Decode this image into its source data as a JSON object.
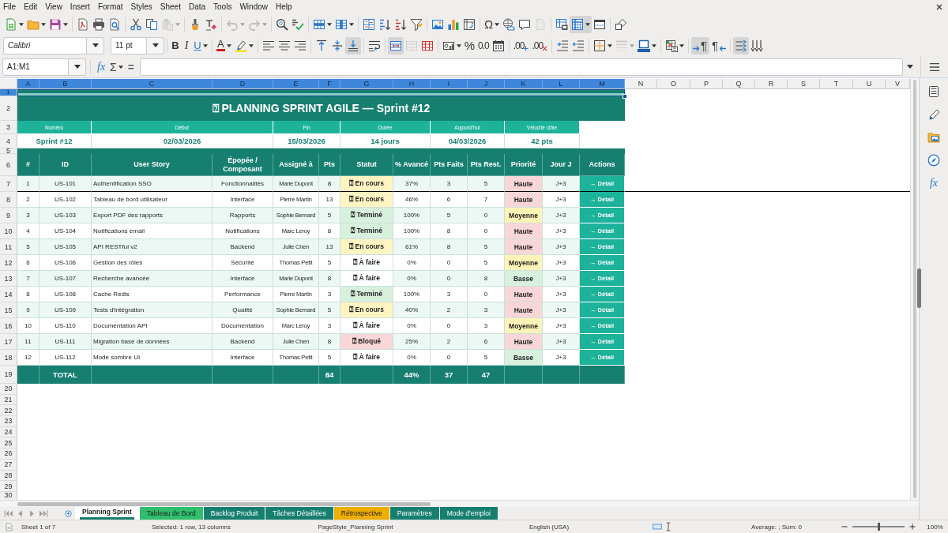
{
  "menu_bar": {
    "items": [
      "File",
      "Edit",
      "View",
      "Insert",
      "Format",
      "Styles",
      "Sheet",
      "Data",
      "Tools",
      "Window",
      "Help"
    ]
  },
  "standard_toolbar": {
    "buttons": [
      {
        "pressed": false,
        "disabled": false
      },
      {
        "pressed": false,
        "disabled": false
      },
      {
        "pressed": false,
        "disabled": false
      },
      {
        "pressed": false,
        "disabled": false
      },
      {
        "pressed": false,
        "disabled": false
      },
      {
        "pressed": false,
        "disabled": false
      },
      {
        "pressed": false,
        "disabled": false
      },
      {
        "pressed": false,
        "disabled": false
      },
      {
        "pressed": false,
        "disabled": true
      },
      {
        "pressed": false,
        "disabled": false
      },
      {
        "pressed": false,
        "disabled": false
      },
      {
        "pressed": false,
        "disabled": true
      },
      {
        "pressed": false,
        "disabled": true
      },
      {
        "pressed": false,
        "disabled": false
      },
      {
        "pressed": false,
        "disabled": false
      },
      {
        "pressed": false,
        "disabled": false
      },
      {
        "pressed": false,
        "disabled": false
      },
      {
        "pressed": false,
        "disabled": false
      },
      {
        "pressed": false,
        "disabled": false
      },
      {
        "pressed": false,
        "disabled": false
      },
      {
        "pressed": false,
        "disabled": false
      },
      {
        "pressed": false,
        "disabled": false
      },
      {
        "pressed": false,
        "disabled": false
      },
      {
        "pressed": false,
        "disabled": false
      },
      {
        "label": "Ω",
        "pressed": false,
        "disabled": false
      },
      {
        "pressed": false,
        "disabled": false
      },
      {
        "pressed": false,
        "disabled": false
      },
      {
        "pressed": false,
        "disabled": true
      },
      {
        "pressed": false,
        "disabled": false
      },
      {
        "pressed": true,
        "disabled": false
      },
      {
        "pressed": false,
        "disabled": false
      },
      {
        "pressed": false,
        "disabled": false
      }
    ]
  },
  "formatting_toolbar": {
    "font_name": "Calibri",
    "font_size": "11 pt",
    "buttons": [
      {
        "label": "B",
        "pressed": false,
        "disabled": false
      },
      {
        "label": "I",
        "pressed": false,
        "disabled": false
      },
      {
        "label": "U",
        "pressed": false,
        "disabled": false
      },
      {
        "label": "A",
        "pressed": false,
        "disabled": false
      },
      {
        "pressed": false,
        "disabled": false
      },
      {
        "pressed": false,
        "disabled": false
      },
      {
        "pressed": false,
        "disabled": false
      },
      {
        "pressed": false,
        "disabled": false
      },
      {
        "pressed": false,
        "disabled": false
      },
      {
        "pressed": false,
        "disabled": false
      },
      {
        "pressed": true,
        "disabled": false
      },
      {
        "pressed": false,
        "disabled": false
      },
      {
        "pressed": true,
        "disabled": false
      },
      {
        "pressed": false,
        "disabled": true
      },
      {
        "pressed": false,
        "disabled": false
      },
      {
        "pressed": false,
        "disabled": false
      },
      {
        "label": "%",
        "pressed": false,
        "disabled": false
      },
      {
        "label": "0.0",
        "pressed": false,
        "disabled": false
      },
      {
        "pressed": false,
        "disabled": false
      },
      {
        "label": ".00",
        "pressed": false,
        "disabled": false
      },
      {
        "label": ".00",
        "pressed": false,
        "disabled": false
      },
      {
        "pressed": false,
        "disabled": false
      },
      {
        "pressed": false,
        "disabled": false
      },
      {
        "pressed": false,
        "disabled": false
      },
      {
        "pressed": false,
        "disabled": true
      },
      {
        "pressed": false,
        "disabled": false
      },
      {
        "pressed": false,
        "disabled": false
      },
      {
        "label": "¶",
        "pressed": true,
        "disabled": false
      },
      {
        "label": "¶",
        "pressed": false,
        "disabled": false
      },
      {
        "pressed": true,
        "disabled": false
      },
      {
        "pressed": false,
        "disabled": false
      }
    ]
  },
  "formula_bar": {
    "name_box": "A1:M1",
    "buttons": [
      "fx",
      "Σ",
      "="
    ]
  },
  "sheet": {
    "column_headers": [
      {
        "label": "A",
        "selected": true
      },
      {
        "label": "B",
        "selected": true
      },
      {
        "label": "C",
        "selected": true
      },
      {
        "label": "D",
        "selected": true
      },
      {
        "label": "E",
        "selected": true
      },
      {
        "label": "F",
        "selected": true
      },
      {
        "label": "G",
        "selected": true
      },
      {
        "label": "H",
        "selected": true
      },
      {
        "label": "I",
        "selected": true
      },
      {
        "label": "J",
        "selected": true
      },
      {
        "label": "K",
        "selected": true
      },
      {
        "label": "L",
        "selected": true
      },
      {
        "label": "M",
        "selected": true
      },
      {
        "label": "N",
        "selected": false
      },
      {
        "label": "O",
        "selected": false
      },
      {
        "label": "P",
        "selected": false
      },
      {
        "label": "Q",
        "selected": false
      },
      {
        "label": "R",
        "selected": false
      },
      {
        "label": "S",
        "selected": false
      },
      {
        "label": "T",
        "selected": false
      },
      {
        "label": "U",
        "selected": false
      },
      {
        "label": "V",
        "selected": false
      }
    ],
    "row_headers": [
      {
        "label": "1",
        "selected": true
      },
      {
        "label": "2",
        "selected": false
      },
      {
        "label": "3",
        "selected": false
      },
      {
        "label": "4",
        "selected": false
      },
      {
        "label": "5",
        "selected": false
      },
      {
        "label": "6",
        "selected": false
      },
      {
        "label": "7",
        "selected": false
      },
      {
        "label": "8",
        "selected": false
      },
      {
        "label": "9",
        "selected": false
      },
      {
        "label": "10",
        "selected": false
      },
      {
        "label": "11",
        "selected": false
      },
      {
        "label": "12",
        "selected": false
      },
      {
        "label": "13",
        "selected": false
      },
      {
        "label": "14",
        "selected": false
      },
      {
        "label": "15",
        "selected": false
      },
      {
        "label": "16",
        "selected": false
      },
      {
        "label": "17",
        "selected": false
      },
      {
        "label": "18",
        "selected": false
      },
      {
        "label": "19",
        "selected": false
      },
      {
        "label": "20",
        "selected": false
      },
      {
        "label": "21",
        "selected": false
      },
      {
        "label": "22",
        "selected": false
      },
      {
        "label": "23",
        "selected": false
      },
      {
        "label": "24",
        "selected": false
      },
      {
        "label": "25",
        "selected": false
      },
      {
        "label": "26",
        "selected": false
      },
      {
        "label": "27",
        "selected": false
      },
      {
        "label": "28",
        "selected": false
      },
      {
        "label": "29",
        "selected": false
      },
      {
        "label": "30",
        "selected": false
      }
    ],
    "title": "⍰ PLANNING SPRINT AGILE — Sprint #12",
    "sprint_info": [
      {
        "label": "Numéro",
        "value": "Sprint #12"
      },
      {
        "label": "Début",
        "value": "02/03/2026"
      },
      {
        "label": "Fin",
        "value": "15/03/2026"
      },
      {
        "label": "Durée",
        "value": "14 jours"
      },
      {
        "label": "Aujourd'hui",
        "value": "04/03/2026"
      },
      {
        "label": "Vélocité cible",
        "value": "42 pts"
      }
    ],
    "table": {
      "columns": [
        "#",
        "ID",
        "User Story",
        "Épopée / Composant",
        "Assigné à",
        "Pts",
        "Statut",
        "% Avancé",
        "Pts Faits",
        "Pts Rest.",
        "Priorité",
        "Jour J",
        "Actions"
      ],
      "rows": [
        {
          "number": "1",
          "id": "US-101",
          "story": "Authentification SSO",
          "epic": "Fonctionnalités",
          "assignee": "Marie Dupont",
          "points": "8",
          "status": {
            "text": "⍰ En cours",
            "color": "#fff4c2"
          },
          "progress": "37%",
          "points_done": "3",
          "points_remaining": "5",
          "priority": {
            "text": "Haute",
            "color": "#f9d6d8"
          },
          "day": "J+3",
          "action": "→ Détail"
        },
        {
          "number": "2",
          "id": "US-102",
          "story": "Tableau de bord utilisateur",
          "epic": "Interface",
          "assignee": "Pierre Martin",
          "points": "13",
          "status": {
            "text": "⍰ En cours",
            "color": "#fff4c2"
          },
          "progress": "46%",
          "points_done": "6",
          "points_remaining": "7",
          "priority": {
            "text": "Haute",
            "color": "#f9d6d8"
          },
          "day": "J+3",
          "action": "→ Détail"
        },
        {
          "number": "3",
          "id": "US-103",
          "story": "Export PDF des rapports",
          "epic": "Rapports",
          "assignee": "Sophie Bernard",
          "points": "5",
          "status": {
            "text": "⍰ Terminé",
            "color": "#d8f1dd"
          },
          "progress": "100%",
          "points_done": "5",
          "points_remaining": "0",
          "priority": {
            "text": "Moyenne",
            "color": "#fff4b8"
          },
          "day": "J+3",
          "action": "→ Détail"
        },
        {
          "number": "4",
          "id": "US-104",
          "story": "Notifications email",
          "epic": "Notifications",
          "assignee": "Marc Leroy",
          "points": "8",
          "status": {
            "text": "⍰ Terminé",
            "color": "#d8f1dd"
          },
          "progress": "100%",
          "points_done": "8",
          "points_remaining": "0",
          "priority": {
            "text": "Haute",
            "color": "#f9d6d8"
          },
          "day": "J+3",
          "action": "→ Détail"
        },
        {
          "number": "5",
          "id": "US-105",
          "story": "API RESTful v2",
          "epic": "Backend",
          "assignee": "Julie Chen",
          "points": "13",
          "status": {
            "text": "⍰ En cours",
            "color": "#fff4c2"
          },
          "progress": "61%",
          "points_done": "8",
          "points_remaining": "5",
          "priority": {
            "text": "Haute",
            "color": "#f9d6d8"
          },
          "day": "J+3",
          "action": "→ Détail"
        },
        {
          "number": "6",
          "id": "US-106",
          "story": "Gestion des rôles",
          "epic": "Sécurité",
          "assignee": "Thomas Petit",
          "points": "5",
          "status": {
            "text": "⍰ À faire",
            "color": "#ffffff"
          },
          "progress": "0%",
          "points_done": "0",
          "points_remaining": "5",
          "priority": {
            "text": "Moyenne",
            "color": "#fff4b8"
          },
          "day": "J+3",
          "action": "→ Détail"
        },
        {
          "number": "7",
          "id": "US-107",
          "story": "Recherche avancée",
          "epic": "Interface",
          "assignee": "Marie Dupont",
          "points": "8",
          "status": {
            "text": "⍰ À faire",
            "color": "#ffffff"
          },
          "progress": "0%",
          "points_done": "0",
          "points_remaining": "8",
          "priority": {
            "text": "Basse",
            "color": "#d8f1dd"
          },
          "day": "J+3",
          "action": "→ Détail"
        },
        {
          "number": "8",
          "id": "US-108",
          "story": "Cache Redis",
          "epic": "Performance",
          "assignee": "Pierre Martin",
          "points": "3",
          "status": {
            "text": "⍰ Terminé",
            "color": "#d8f1dd"
          },
          "progress": "100%",
          "points_done": "3",
          "points_remaining": "0",
          "priority": {
            "text": "Haute",
            "color": "#f9d6d8"
          },
          "day": "J+3",
          "action": "→ Détail"
        },
        {
          "number": "9",
          "id": "US-109",
          "story": "Tests d'intégration",
          "epic": "Qualité",
          "assignee": "Sophie Bernard",
          "points": "5",
          "status": {
            "text": "⍰ En cours",
            "color": "#fff4c2"
          },
          "progress": "40%",
          "points_done": "2",
          "points_remaining": "3",
          "priority": {
            "text": "Haute",
            "color": "#f9d6d8"
          },
          "day": "J+3",
          "action": "→ Détail"
        },
        {
          "number": "10",
          "id": "US-110",
          "story": "Documentation API",
          "epic": "Documentation",
          "assignee": "Marc Leroy",
          "points": "3",
          "status": {
            "text": "⍰ À faire",
            "color": "#ffffff"
          },
          "progress": "0%",
          "points_done": "0",
          "points_remaining": "3",
          "priority": {
            "text": "Moyenne",
            "color": "#fff4b8"
          },
          "day": "J+3",
          "action": "→ Détail"
        },
        {
          "number": "11",
          "id": "US-111",
          "story": "Migration base de données",
          "epic": "Backend",
          "assignee": "Julie Chen",
          "points": "8",
          "status": {
            "text": "⍰ Bloqué",
            "color": "#f9d6d8"
          },
          "progress": "25%",
          "points_done": "2",
          "points_remaining": "6",
          "priority": {
            "text": "Haute",
            "color": "#f9d6d8"
          },
          "day": "J+3",
          "action": "→ Détail"
        },
        {
          "number": "12",
          "id": "US-112",
          "story": "Mode sombre UI",
          "epic": "Interface",
          "assignee": "Thomas Petit",
          "points": "5",
          "status": {
            "text": "⍰ À faire",
            "color": "#ffffff"
          },
          "progress": "0%",
          "points_done": "0",
          "points_remaining": "5",
          "priority": {
            "text": "Basse",
            "color": "#d8f1dd"
          },
          "day": "J+3",
          "action": "→ Détail"
        }
      ],
      "total": {
        "label": "TOTAL",
        "points": "84",
        "progress": "44%",
        "points_done": "37",
        "points_remaining": "47"
      }
    }
  },
  "sidebar": {
    "functions_tab": "fx"
  },
  "sheet_tabs": [
    {
      "label": "Planning Sprint",
      "selected": true,
      "color": "#177f70"
    },
    {
      "label": "Tableau de Bord",
      "selected": false,
      "color": "#2fbf6e"
    },
    {
      "label": "Backlog Produit",
      "selected": false,
      "color": "#177f70"
    },
    {
      "label": "Tâches Détaillées",
      "selected": false,
      "color": "#177f70"
    },
    {
      "label": "Rétrospective",
      "selected": false,
      "color": "#eeae00"
    },
    {
      "label": "Paramètres",
      "selected": false,
      "color": "#177f70"
    },
    {
      "label": "Mode d'emploi",
      "selected": false,
      "color": "#177f70"
    }
  ],
  "status_bar": {
    "sheet_position": "Sheet 1 of 7",
    "selection": "Selected: 1 row, 13 columns",
    "page_style": "PageStyle_Planning Sprint",
    "language": "English (USA)",
    "statistics": "Average: ; Sum: 0",
    "zoom": {
      "level": 0.5
    },
    "zoom_percent": "100%"
  }
}
